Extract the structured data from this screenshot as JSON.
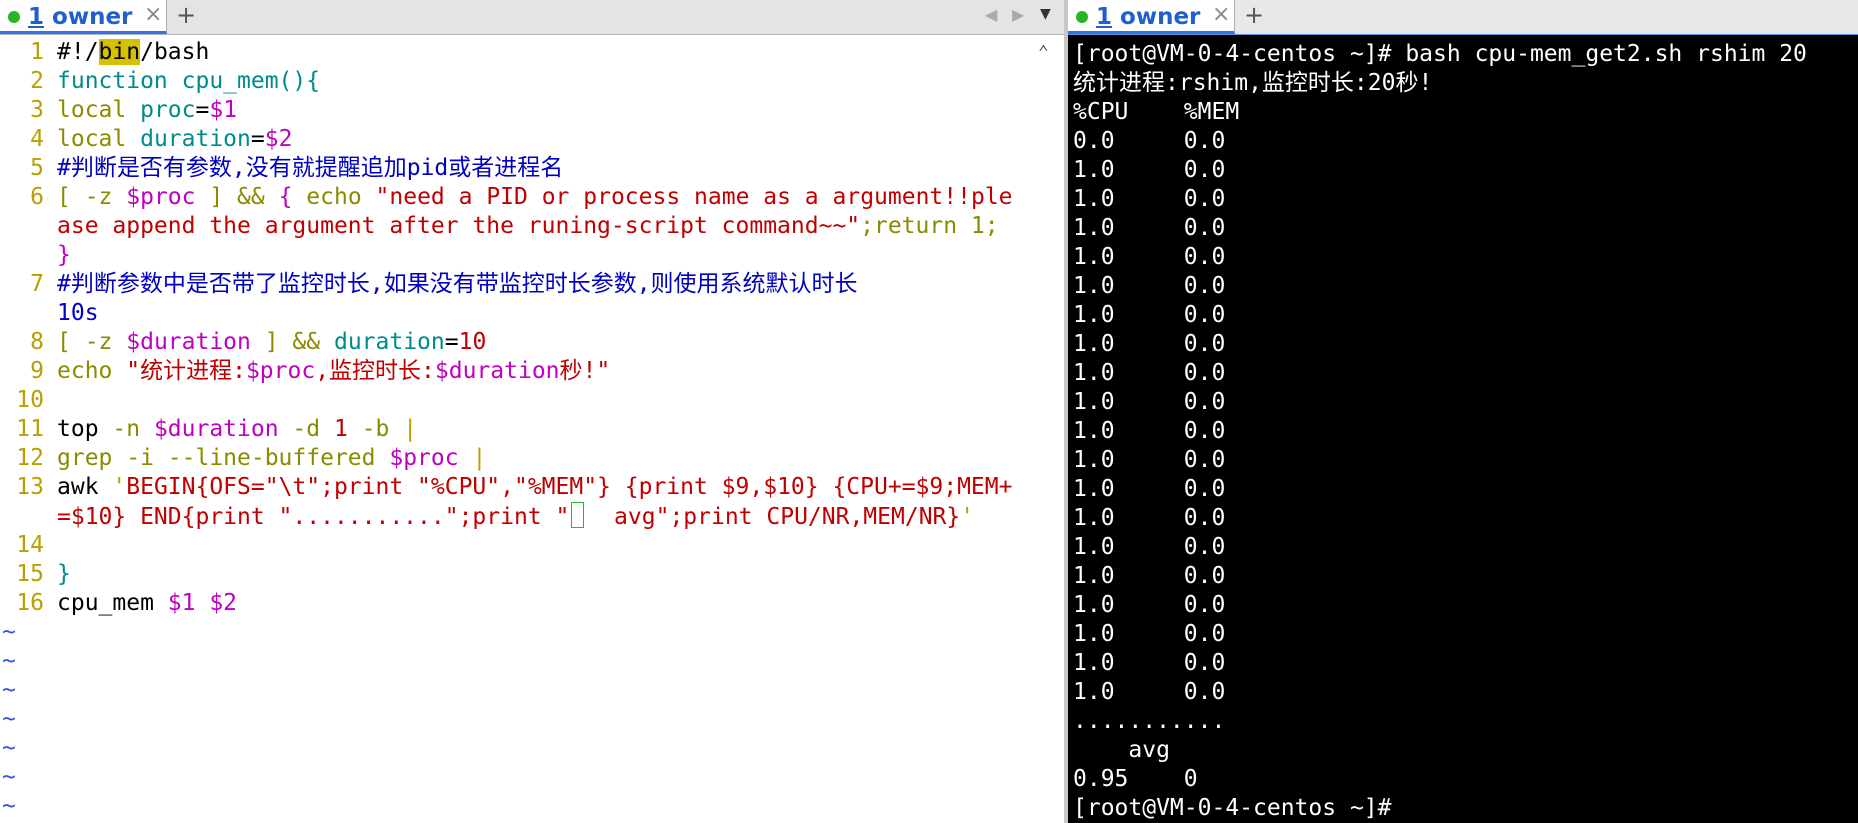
{
  "left_tab": {
    "number": "1",
    "title": " owner",
    "close": "×",
    "add": "+"
  },
  "left_nav": {
    "prev": "◀",
    "next": "▶",
    "menu": "▼"
  },
  "right_tab": {
    "number": "1",
    "title": " owner",
    "close": "×",
    "add": "+"
  },
  "editor": {
    "line_numbers": [
      "1",
      "2",
      "3",
      "4",
      "5",
      "6",
      "",
      "",
      "7",
      "",
      "8",
      "9",
      "10",
      "11",
      "12",
      "13",
      "",
      "14",
      "15",
      "16"
    ],
    "lines": [
      [
        [
          "def",
          "#!/"
        ],
        [
          "hl",
          "bin"
        ],
        [
          "def",
          "/bash"
        ]
      ],
      [
        [
          "kw",
          "function cpu_mem(){"
        ]
      ],
      [
        [
          "op",
          "local "
        ],
        [
          "kw",
          "proc"
        ],
        [
          "def",
          "="
        ],
        [
          "var",
          "$1"
        ]
      ],
      [
        [
          "op",
          "local "
        ],
        [
          "kw",
          "duration"
        ],
        [
          "def",
          "="
        ],
        [
          "var",
          "$2"
        ]
      ],
      [
        [
          "com",
          "#判断是否有参数,没有就提醒追加pid或者进程名"
        ]
      ],
      [
        [
          "op",
          "[ -z "
        ],
        [
          "var",
          "$proc"
        ],
        [
          "op",
          " ] && "
        ],
        [
          "var",
          "{"
        ],
        [
          "op",
          " echo "
        ],
        [
          "str",
          "\"need a PID or process name as a argument!!ple"
        ]
      ],
      [
        [
          "str",
          "ase append the argument after the runing-script command~~\""
        ],
        [
          "op",
          ";return 1;"
        ]
      ],
      [
        [
          "var",
          "}"
        ]
      ],
      [
        [
          "com",
          "#判断参数中是否带了监控时长,如果没有带监控时长参数,则使用系统默认时长"
        ]
      ],
      [
        [
          "com",
          "10s"
        ]
      ],
      [
        [
          "op",
          "[ -z "
        ],
        [
          "var",
          "$duration"
        ],
        [
          "op",
          " ] && "
        ],
        [
          "kw",
          "duration"
        ],
        [
          "def",
          "="
        ],
        [
          "str",
          "10"
        ]
      ],
      [
        [
          "op",
          "echo "
        ],
        [
          "str",
          "\"统计进程:"
        ],
        [
          "var",
          "$proc"
        ],
        [
          "str",
          ",监控时长:"
        ],
        [
          "var",
          "$duration"
        ],
        [
          "str",
          "秒!\""
        ]
      ],
      [],
      [
        [
          "def",
          "top "
        ],
        [
          "op",
          "-n "
        ],
        [
          "var",
          "$duration"
        ],
        [
          "op",
          " -d "
        ],
        [
          "str",
          "1"
        ],
        [
          "op",
          " -b "
        ],
        [
          "cmd",
          "|"
        ]
      ],
      [
        [
          "op",
          "grep -i --line-buffered "
        ],
        [
          "var",
          "$proc"
        ],
        [
          "cmd",
          " |"
        ]
      ],
      [
        [
          "def",
          "awk "
        ],
        [
          "cmd",
          "'"
        ],
        [
          "str",
          "BEGIN{OFS=\"\\t\";print \"%CPU\",\"%MEM\"} {print $9,$10} {CPU+=$9;MEM+"
        ]
      ],
      [
        [
          "str",
          "=$10} END{print \"...........\";print \""
        ],
        [
          "cur",
          " "
        ],
        [
          "str",
          "  avg\";print CPU/NR,MEM/NR}"
        ],
        [
          "cmd",
          "'"
        ]
      ],
      [],
      [
        [
          "kw",
          "}"
        ]
      ],
      [
        [
          "def",
          "cpu_mem "
        ],
        [
          "var",
          "$1 $2"
        ]
      ]
    ],
    "tildes": [
      "~",
      "~",
      "~",
      "~",
      "~",
      "~",
      "~"
    ]
  },
  "terminal": {
    "lines": [
      "[root@VM-0-4-centos ~]# bash cpu-mem_get2.sh rshim 20",
      "统计进程:rshim,监控时长:20秒!",
      "%CPU    %MEM",
      "0.0     0.0",
      "1.0     0.0",
      "1.0     0.0",
      "1.0     0.0",
      "1.0     0.0",
      "1.0     0.0",
      "1.0     0.0",
      "1.0     0.0",
      "1.0     0.0",
      "1.0     0.0",
      "1.0     0.0",
      "1.0     0.0",
      "1.0     0.0",
      "1.0     0.0",
      "1.0     0.0",
      "1.0     0.0",
      "1.0     0.0",
      "1.0     0.0",
      "1.0     0.0",
      "1.0     0.0",
      "...........",
      "    avg",
      "0.95    0",
      "[root@VM-0-4-centos ~]#"
    ]
  },
  "colors": {
    "accent": "#2f76e4",
    "status_dot": "#26b526",
    "terminal_bg": "#000000",
    "editor_bg": "#ffffff"
  },
  "icons": {
    "tab_dot": "status-dot-icon",
    "close": "close-icon",
    "add": "plus-icon"
  }
}
